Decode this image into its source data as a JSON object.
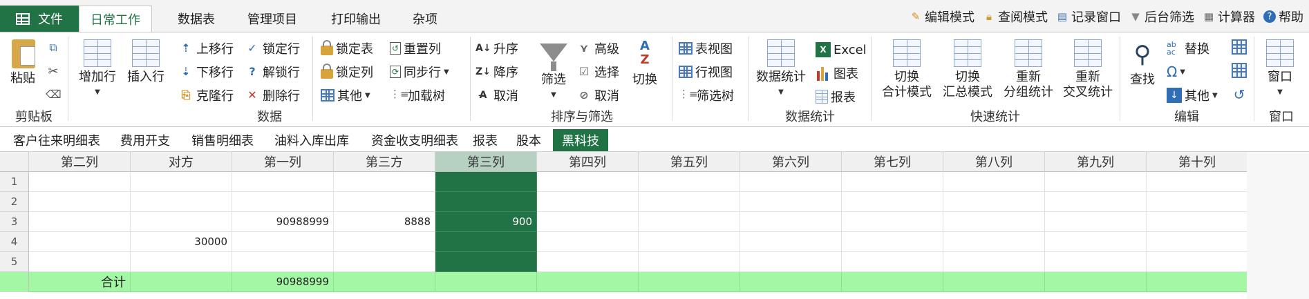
{
  "menu": {
    "file": "文件",
    "tabs": [
      "日常工作",
      "数据表",
      "管理项目",
      "打印输出",
      "杂项"
    ],
    "right": [
      "编辑模式",
      "查阅模式",
      "记录窗口",
      "后台筛选",
      "计算器",
      "帮助"
    ]
  },
  "ribbon": {
    "clipboard": {
      "label": "剪贴板",
      "paste": "粘贴"
    },
    "data": {
      "label": "数据",
      "add_row": "增加行",
      "insert_row": "插入行",
      "move_up": "上移行",
      "move_down": "下移行",
      "clone_row": "克隆行",
      "lock_row": "锁定行",
      "unlock_row": "解锁行",
      "delete_row": "删除行",
      "lock_table": "锁定表",
      "lock_col": "锁定列",
      "other": "其他",
      "reset_col": "重置列",
      "sync_row": "同步行",
      "load_tree": "加载树"
    },
    "sort_filter": {
      "label": "排序与筛选",
      "asc": "升序",
      "desc": "降序",
      "cancel": "取消",
      "filter": "筛选",
      "advanced": "高级",
      "select": "选择",
      "cancel2": "取消",
      "switch": "切换"
    },
    "views": {
      "table_view": "表视图",
      "row_view": "行视图",
      "filter_tree": "筛选树"
    },
    "stats": {
      "label": "数据统计",
      "button": "数据统计",
      "excel": "Excel",
      "chart": "图表",
      "report": "报表"
    },
    "quick": {
      "label": "快速统计",
      "buttons": [
        [
          "切换",
          "合计模式"
        ],
        [
          "切换",
          "汇总模式"
        ],
        [
          "重新",
          "分组统计"
        ],
        [
          "重新",
          "交叉统计"
        ]
      ]
    },
    "edit": {
      "label": "编辑",
      "find": "查找",
      "replace": "替换",
      "other": "其他",
      "omega": "Ω"
    },
    "window": {
      "label": "窗口",
      "button": "窗口"
    }
  },
  "sheet_tabs": [
    "客户往来明细表",
    "费用开支",
    "销售明细表",
    "油料入库出库",
    "资金收支明细表",
    "报表",
    "股本",
    "黑科技"
  ],
  "active_sheet": 7,
  "grid": {
    "columns": [
      "第二列",
      "对方",
      "第一列",
      "第三方",
      "第三列",
      "第四列",
      "第五列",
      "第六列",
      "第七列",
      "第八列",
      "第九列",
      "第十列"
    ],
    "selected_column": 4,
    "rows": [
      {
        "num": "1",
        "cells": [
          "",
          "",
          "",
          "",
          "",
          "",
          "",
          "",
          "",
          "",
          "",
          ""
        ]
      },
      {
        "num": "2",
        "cells": [
          "",
          "",
          "",
          "",
          "",
          "",
          "",
          "",
          "",
          "",
          "",
          ""
        ]
      },
      {
        "num": "3",
        "cells": [
          "",
          "",
          "90988999",
          "8888",
          "900",
          "",
          "",
          "",
          "",
          "",
          "",
          ""
        ]
      },
      {
        "num": "4",
        "cells": [
          "",
          "30000",
          "",
          "",
          "",
          "",
          "",
          "",
          "",
          "",
          "",
          ""
        ]
      },
      {
        "num": "5",
        "cells": [
          "",
          "",
          "",
          "",
          "",
          "",
          "",
          "",
          "",
          "",
          "",
          ""
        ]
      }
    ],
    "total_row": {
      "label": "合计",
      "cells": [
        "",
        "",
        "90988999",
        "",
        "",
        "",
        "",
        "",
        "",
        "",
        "",
        ""
      ]
    }
  },
  "colors": {
    "accent": "#217346",
    "selected_header": "#b6d0c2",
    "total_row": "#a4f7a4"
  }
}
